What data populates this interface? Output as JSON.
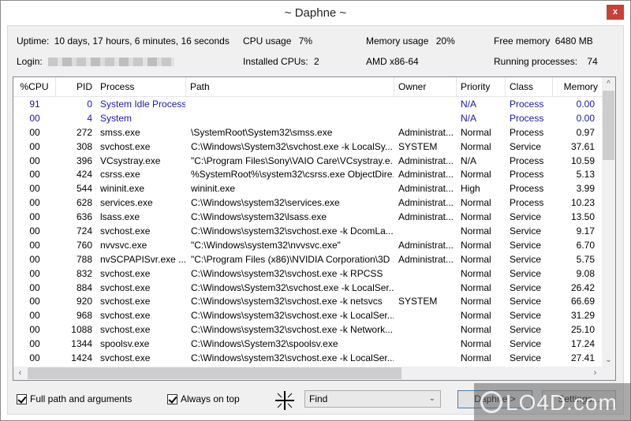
{
  "window": {
    "title": "~ Daphne ~",
    "close_label": "x"
  },
  "info": {
    "uptime_label": "Uptime:",
    "uptime_value": "10 days, 17 hours,  6 minutes, 16 seconds",
    "cpu_usage_label": "CPU usage",
    "cpu_usage_value": "7%",
    "memory_usage_label": "Memory usage",
    "memory_usage_value": "20%",
    "free_memory_label": "Free memory",
    "free_memory_value": "6480 MB",
    "login_label": "Login:",
    "login_value": "",
    "installed_cpus_label": "Installed CPUs:",
    "installed_cpus_value": "2",
    "cpu_arch": "AMD x86-64",
    "running_processes_label": "Running processes:",
    "running_processes_value": "74"
  },
  "table": {
    "columns": [
      "%CPU",
      "PID",
      "Process",
      "Path",
      "Owner",
      "Priority",
      "Class",
      "Memory"
    ],
    "rows": [
      {
        "cpu": "91",
        "pid": "0",
        "process": "System Idle Process",
        "path": "",
        "owner": "",
        "priority": "N/A",
        "class": "Process",
        "memory": "0.00",
        "system": true
      },
      {
        "cpu": "00",
        "pid": "4",
        "process": "System",
        "path": "",
        "owner": "",
        "priority": "N/A",
        "class": "Process",
        "memory": "0.00",
        "system": true
      },
      {
        "cpu": "00",
        "pid": "272",
        "process": "smss.exe",
        "path": "\\SystemRoot\\System32\\smss.exe",
        "owner": "Administrat...",
        "priority": "Normal",
        "class": "Process",
        "memory": "0.97"
      },
      {
        "cpu": "00",
        "pid": "308",
        "process": "svchost.exe",
        "path": "C:\\Windows\\System32\\svchost.exe -k LocalSy...",
        "owner": "SYSTEM",
        "priority": "Normal",
        "class": "Service",
        "memory": "37.61"
      },
      {
        "cpu": "00",
        "pid": "396",
        "process": "VCsystray.exe",
        "path": "\"C:\\Program Files\\Sony\\VAIO Care\\VCsystray.e...",
        "owner": "Administrat...",
        "priority": "N/A",
        "class": "Process",
        "memory": "10.59"
      },
      {
        "cpu": "00",
        "pid": "424",
        "process": "csrss.exe",
        "path": "%SystemRoot%\\system32\\csrss.exe ObjectDire...",
        "owner": "Administrat...",
        "priority": "Normal",
        "class": "Process",
        "memory": "5.13"
      },
      {
        "cpu": "00",
        "pid": "544",
        "process": "wininit.exe",
        "path": "wininit.exe",
        "owner": "Administrat...",
        "priority": "High",
        "class": "Process",
        "memory": "3.99"
      },
      {
        "cpu": "00",
        "pid": "628",
        "process": "services.exe",
        "path": "C:\\Windows\\system32\\services.exe",
        "owner": "Administrat...",
        "priority": "Normal",
        "class": "Process",
        "memory": "10.23"
      },
      {
        "cpu": "00",
        "pid": "636",
        "process": "lsass.exe",
        "path": "C:\\Windows\\system32\\lsass.exe",
        "owner": "Administrat...",
        "priority": "Normal",
        "class": "Service",
        "memory": "13.50"
      },
      {
        "cpu": "00",
        "pid": "724",
        "process": "svchost.exe",
        "path": "C:\\Windows\\system32\\svchost.exe -k DcomLa...",
        "owner": "",
        "priority": "Normal",
        "class": "Service",
        "memory": "9.17"
      },
      {
        "cpu": "00",
        "pid": "760",
        "process": "nvvsvc.exe",
        "path": "\"C:\\Windows\\system32\\nvvsvc.exe\"",
        "owner": "Administrat...",
        "priority": "Normal",
        "class": "Service",
        "memory": "6.70"
      },
      {
        "cpu": "00",
        "pid": "788",
        "process": "nvSCPAPISvr.exe ...",
        "path": "\"C:\\Program Files (x86)\\NVIDIA Corporation\\3D ...",
        "owner": "Administrat...",
        "priority": "Normal",
        "class": "Service",
        "memory": "5.75"
      },
      {
        "cpu": "00",
        "pid": "832",
        "process": "svchost.exe",
        "path": "C:\\Windows\\system32\\svchost.exe -k RPCSS",
        "owner": "",
        "priority": "Normal",
        "class": "Service",
        "memory": "9.08"
      },
      {
        "cpu": "00",
        "pid": "884",
        "process": "svchost.exe",
        "path": "C:\\Windows\\System32\\svchost.exe -k LocalSer...",
        "owner": "",
        "priority": "Normal",
        "class": "Service",
        "memory": "26.42"
      },
      {
        "cpu": "00",
        "pid": "920",
        "process": "svchost.exe",
        "path": "C:\\Windows\\system32\\svchost.exe -k netsvcs",
        "owner": "SYSTEM",
        "priority": "Normal",
        "class": "Service",
        "memory": "66.69"
      },
      {
        "cpu": "00",
        "pid": "968",
        "process": "svchost.exe",
        "path": "C:\\Windows\\system32\\svchost.exe -k LocalSer...",
        "owner": "",
        "priority": "Normal",
        "class": "Service",
        "memory": "31.29"
      },
      {
        "cpu": "00",
        "pid": "1088",
        "process": "svchost.exe",
        "path": "C:\\Windows\\system32\\svchost.exe -k Network...",
        "owner": "",
        "priority": "Normal",
        "class": "Service",
        "memory": "25.10"
      },
      {
        "cpu": "00",
        "pid": "1344",
        "process": "spoolsv.exe",
        "path": "C:\\Windows\\System32\\spoolsv.exe",
        "owner": "",
        "priority": "Normal",
        "class": "Service",
        "memory": "17.24"
      },
      {
        "cpu": "00",
        "pid": "1424",
        "process": "svchost.exe",
        "path": "C:\\Windows\\system32\\svchost.exe -k LocalSer...",
        "owner": "",
        "priority": "Normal",
        "class": "Service",
        "memory": "27.41"
      }
    ]
  },
  "footer": {
    "full_path_label": "Full path and arguments",
    "full_path_checked": true,
    "always_on_top_label": "Always on top",
    "always_on_top_checked": true,
    "find_value": "Find",
    "daphne_button": "Daphne >",
    "settings_button": "Settings..."
  },
  "watermark": "LO4D.com",
  "colors": {
    "system_row": "#1a1aa6",
    "close_button": "#c7403a"
  }
}
